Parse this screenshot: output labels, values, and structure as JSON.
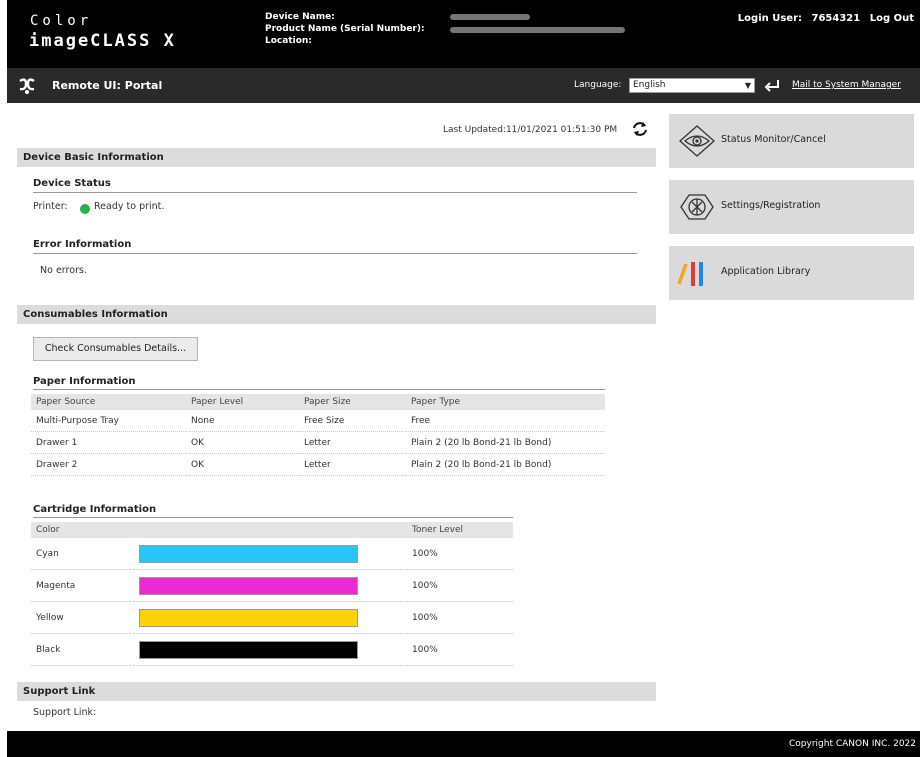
{
  "header": {
    "brand_line1": "Color",
    "brand_line2": "imageCLASS X",
    "device_name_label": "Device Name:",
    "product_name_label": "Product Name (Serial Number):",
    "location_label": "Location:",
    "login_user_label": "Login User:",
    "login_user_value": "7654321",
    "logout_label": "Log Out"
  },
  "portal_bar": {
    "title": "Remote UI: Portal",
    "language_label": "Language:",
    "language_value": "English",
    "mail_link": "Mail to System Manager"
  },
  "main": {
    "last_updated": "Last Updated:11/01/2021 01:51:30 PM",
    "device_basic": {
      "title": "Device Basic Information",
      "device_status_heading": "Device Status",
      "printer_label": "Printer:",
      "printer_status": "Ready to print.",
      "status_color": "#22b14c",
      "error_heading": "Error Information",
      "error_text": "No errors."
    },
    "consumables": {
      "title": "Consumables Information",
      "check_button": "Check Consumables Details...",
      "paper_heading": "Paper Information",
      "paper_columns": [
        "Paper Source",
        "Paper Level",
        "Paper Size",
        "Paper Type"
      ],
      "paper_rows": [
        [
          "Multi-Purpose Tray",
          "None",
          "Free Size",
          "Free"
        ],
        [
          "Drawer 1",
          "OK",
          "Letter",
          "Plain 2 (20 lb Bond-21 lb Bond)"
        ],
        [
          "Drawer 2",
          "OK",
          "Letter",
          "Plain 2 (20 lb Bond-21 lb Bond)"
        ]
      ],
      "cartridge_heading": "Cartridge Information",
      "cartridge_columns": [
        "Color",
        "Toner Level"
      ],
      "cartridges": [
        {
          "name": "Cyan",
          "level": "100%",
          "color": "#29c5f6"
        },
        {
          "name": "Magenta",
          "level": "100%",
          "color": "#ea2bd4"
        },
        {
          "name": "Yellow",
          "level": "100%",
          "color": "#fcd20a"
        },
        {
          "name": "Black",
          "level": "100%",
          "color": "#000000"
        }
      ]
    },
    "support": {
      "title": "Support Link",
      "link_label": "Support Link:"
    }
  },
  "side_menu": {
    "status_monitor": "Status Monitor/Cancel",
    "settings": "Settings/Registration",
    "app_library": "Application Library"
  },
  "footer": {
    "copyright": "Copyright CANON INC. 2022"
  }
}
